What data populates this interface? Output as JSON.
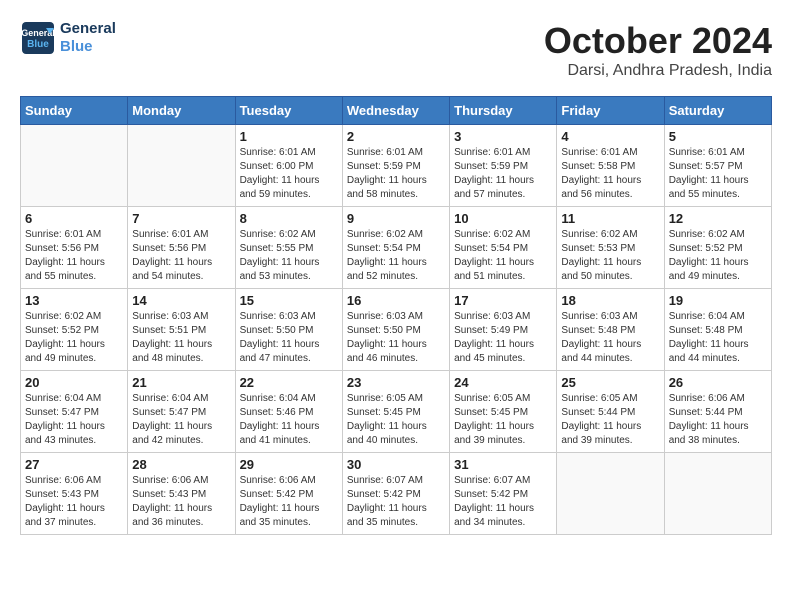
{
  "header": {
    "logo_line1": "General",
    "logo_line2": "Blue",
    "month_title": "October 2024",
    "location": "Darsi, Andhra Pradesh, India"
  },
  "weekdays": [
    "Sunday",
    "Monday",
    "Tuesday",
    "Wednesday",
    "Thursday",
    "Friday",
    "Saturday"
  ],
  "weeks": [
    [
      {
        "day": "",
        "info": ""
      },
      {
        "day": "",
        "info": ""
      },
      {
        "day": "1",
        "info": "Sunrise: 6:01 AM\nSunset: 6:00 PM\nDaylight: 11 hours and 59 minutes."
      },
      {
        "day": "2",
        "info": "Sunrise: 6:01 AM\nSunset: 5:59 PM\nDaylight: 11 hours and 58 minutes."
      },
      {
        "day": "3",
        "info": "Sunrise: 6:01 AM\nSunset: 5:59 PM\nDaylight: 11 hours and 57 minutes."
      },
      {
        "day": "4",
        "info": "Sunrise: 6:01 AM\nSunset: 5:58 PM\nDaylight: 11 hours and 56 minutes."
      },
      {
        "day": "5",
        "info": "Sunrise: 6:01 AM\nSunset: 5:57 PM\nDaylight: 11 hours and 55 minutes."
      }
    ],
    [
      {
        "day": "6",
        "info": "Sunrise: 6:01 AM\nSunset: 5:56 PM\nDaylight: 11 hours and 55 minutes."
      },
      {
        "day": "7",
        "info": "Sunrise: 6:01 AM\nSunset: 5:56 PM\nDaylight: 11 hours and 54 minutes."
      },
      {
        "day": "8",
        "info": "Sunrise: 6:02 AM\nSunset: 5:55 PM\nDaylight: 11 hours and 53 minutes."
      },
      {
        "day": "9",
        "info": "Sunrise: 6:02 AM\nSunset: 5:54 PM\nDaylight: 11 hours and 52 minutes."
      },
      {
        "day": "10",
        "info": "Sunrise: 6:02 AM\nSunset: 5:54 PM\nDaylight: 11 hours and 51 minutes."
      },
      {
        "day": "11",
        "info": "Sunrise: 6:02 AM\nSunset: 5:53 PM\nDaylight: 11 hours and 50 minutes."
      },
      {
        "day": "12",
        "info": "Sunrise: 6:02 AM\nSunset: 5:52 PM\nDaylight: 11 hours and 49 minutes."
      }
    ],
    [
      {
        "day": "13",
        "info": "Sunrise: 6:02 AM\nSunset: 5:52 PM\nDaylight: 11 hours and 49 minutes."
      },
      {
        "day": "14",
        "info": "Sunrise: 6:03 AM\nSunset: 5:51 PM\nDaylight: 11 hours and 48 minutes."
      },
      {
        "day": "15",
        "info": "Sunrise: 6:03 AM\nSunset: 5:50 PM\nDaylight: 11 hours and 47 minutes."
      },
      {
        "day": "16",
        "info": "Sunrise: 6:03 AM\nSunset: 5:50 PM\nDaylight: 11 hours and 46 minutes."
      },
      {
        "day": "17",
        "info": "Sunrise: 6:03 AM\nSunset: 5:49 PM\nDaylight: 11 hours and 45 minutes."
      },
      {
        "day": "18",
        "info": "Sunrise: 6:03 AM\nSunset: 5:48 PM\nDaylight: 11 hours and 44 minutes."
      },
      {
        "day": "19",
        "info": "Sunrise: 6:04 AM\nSunset: 5:48 PM\nDaylight: 11 hours and 44 minutes."
      }
    ],
    [
      {
        "day": "20",
        "info": "Sunrise: 6:04 AM\nSunset: 5:47 PM\nDaylight: 11 hours and 43 minutes."
      },
      {
        "day": "21",
        "info": "Sunrise: 6:04 AM\nSunset: 5:47 PM\nDaylight: 11 hours and 42 minutes."
      },
      {
        "day": "22",
        "info": "Sunrise: 6:04 AM\nSunset: 5:46 PM\nDaylight: 11 hours and 41 minutes."
      },
      {
        "day": "23",
        "info": "Sunrise: 6:05 AM\nSunset: 5:45 PM\nDaylight: 11 hours and 40 minutes."
      },
      {
        "day": "24",
        "info": "Sunrise: 6:05 AM\nSunset: 5:45 PM\nDaylight: 11 hours and 39 minutes."
      },
      {
        "day": "25",
        "info": "Sunrise: 6:05 AM\nSunset: 5:44 PM\nDaylight: 11 hours and 39 minutes."
      },
      {
        "day": "26",
        "info": "Sunrise: 6:06 AM\nSunset: 5:44 PM\nDaylight: 11 hours and 38 minutes."
      }
    ],
    [
      {
        "day": "27",
        "info": "Sunrise: 6:06 AM\nSunset: 5:43 PM\nDaylight: 11 hours and 37 minutes."
      },
      {
        "day": "28",
        "info": "Sunrise: 6:06 AM\nSunset: 5:43 PM\nDaylight: 11 hours and 36 minutes."
      },
      {
        "day": "29",
        "info": "Sunrise: 6:06 AM\nSunset: 5:42 PM\nDaylight: 11 hours and 35 minutes."
      },
      {
        "day": "30",
        "info": "Sunrise: 6:07 AM\nSunset: 5:42 PM\nDaylight: 11 hours and 35 minutes."
      },
      {
        "day": "31",
        "info": "Sunrise: 6:07 AM\nSunset: 5:42 PM\nDaylight: 11 hours and 34 minutes."
      },
      {
        "day": "",
        "info": ""
      },
      {
        "day": "",
        "info": ""
      }
    ]
  ]
}
